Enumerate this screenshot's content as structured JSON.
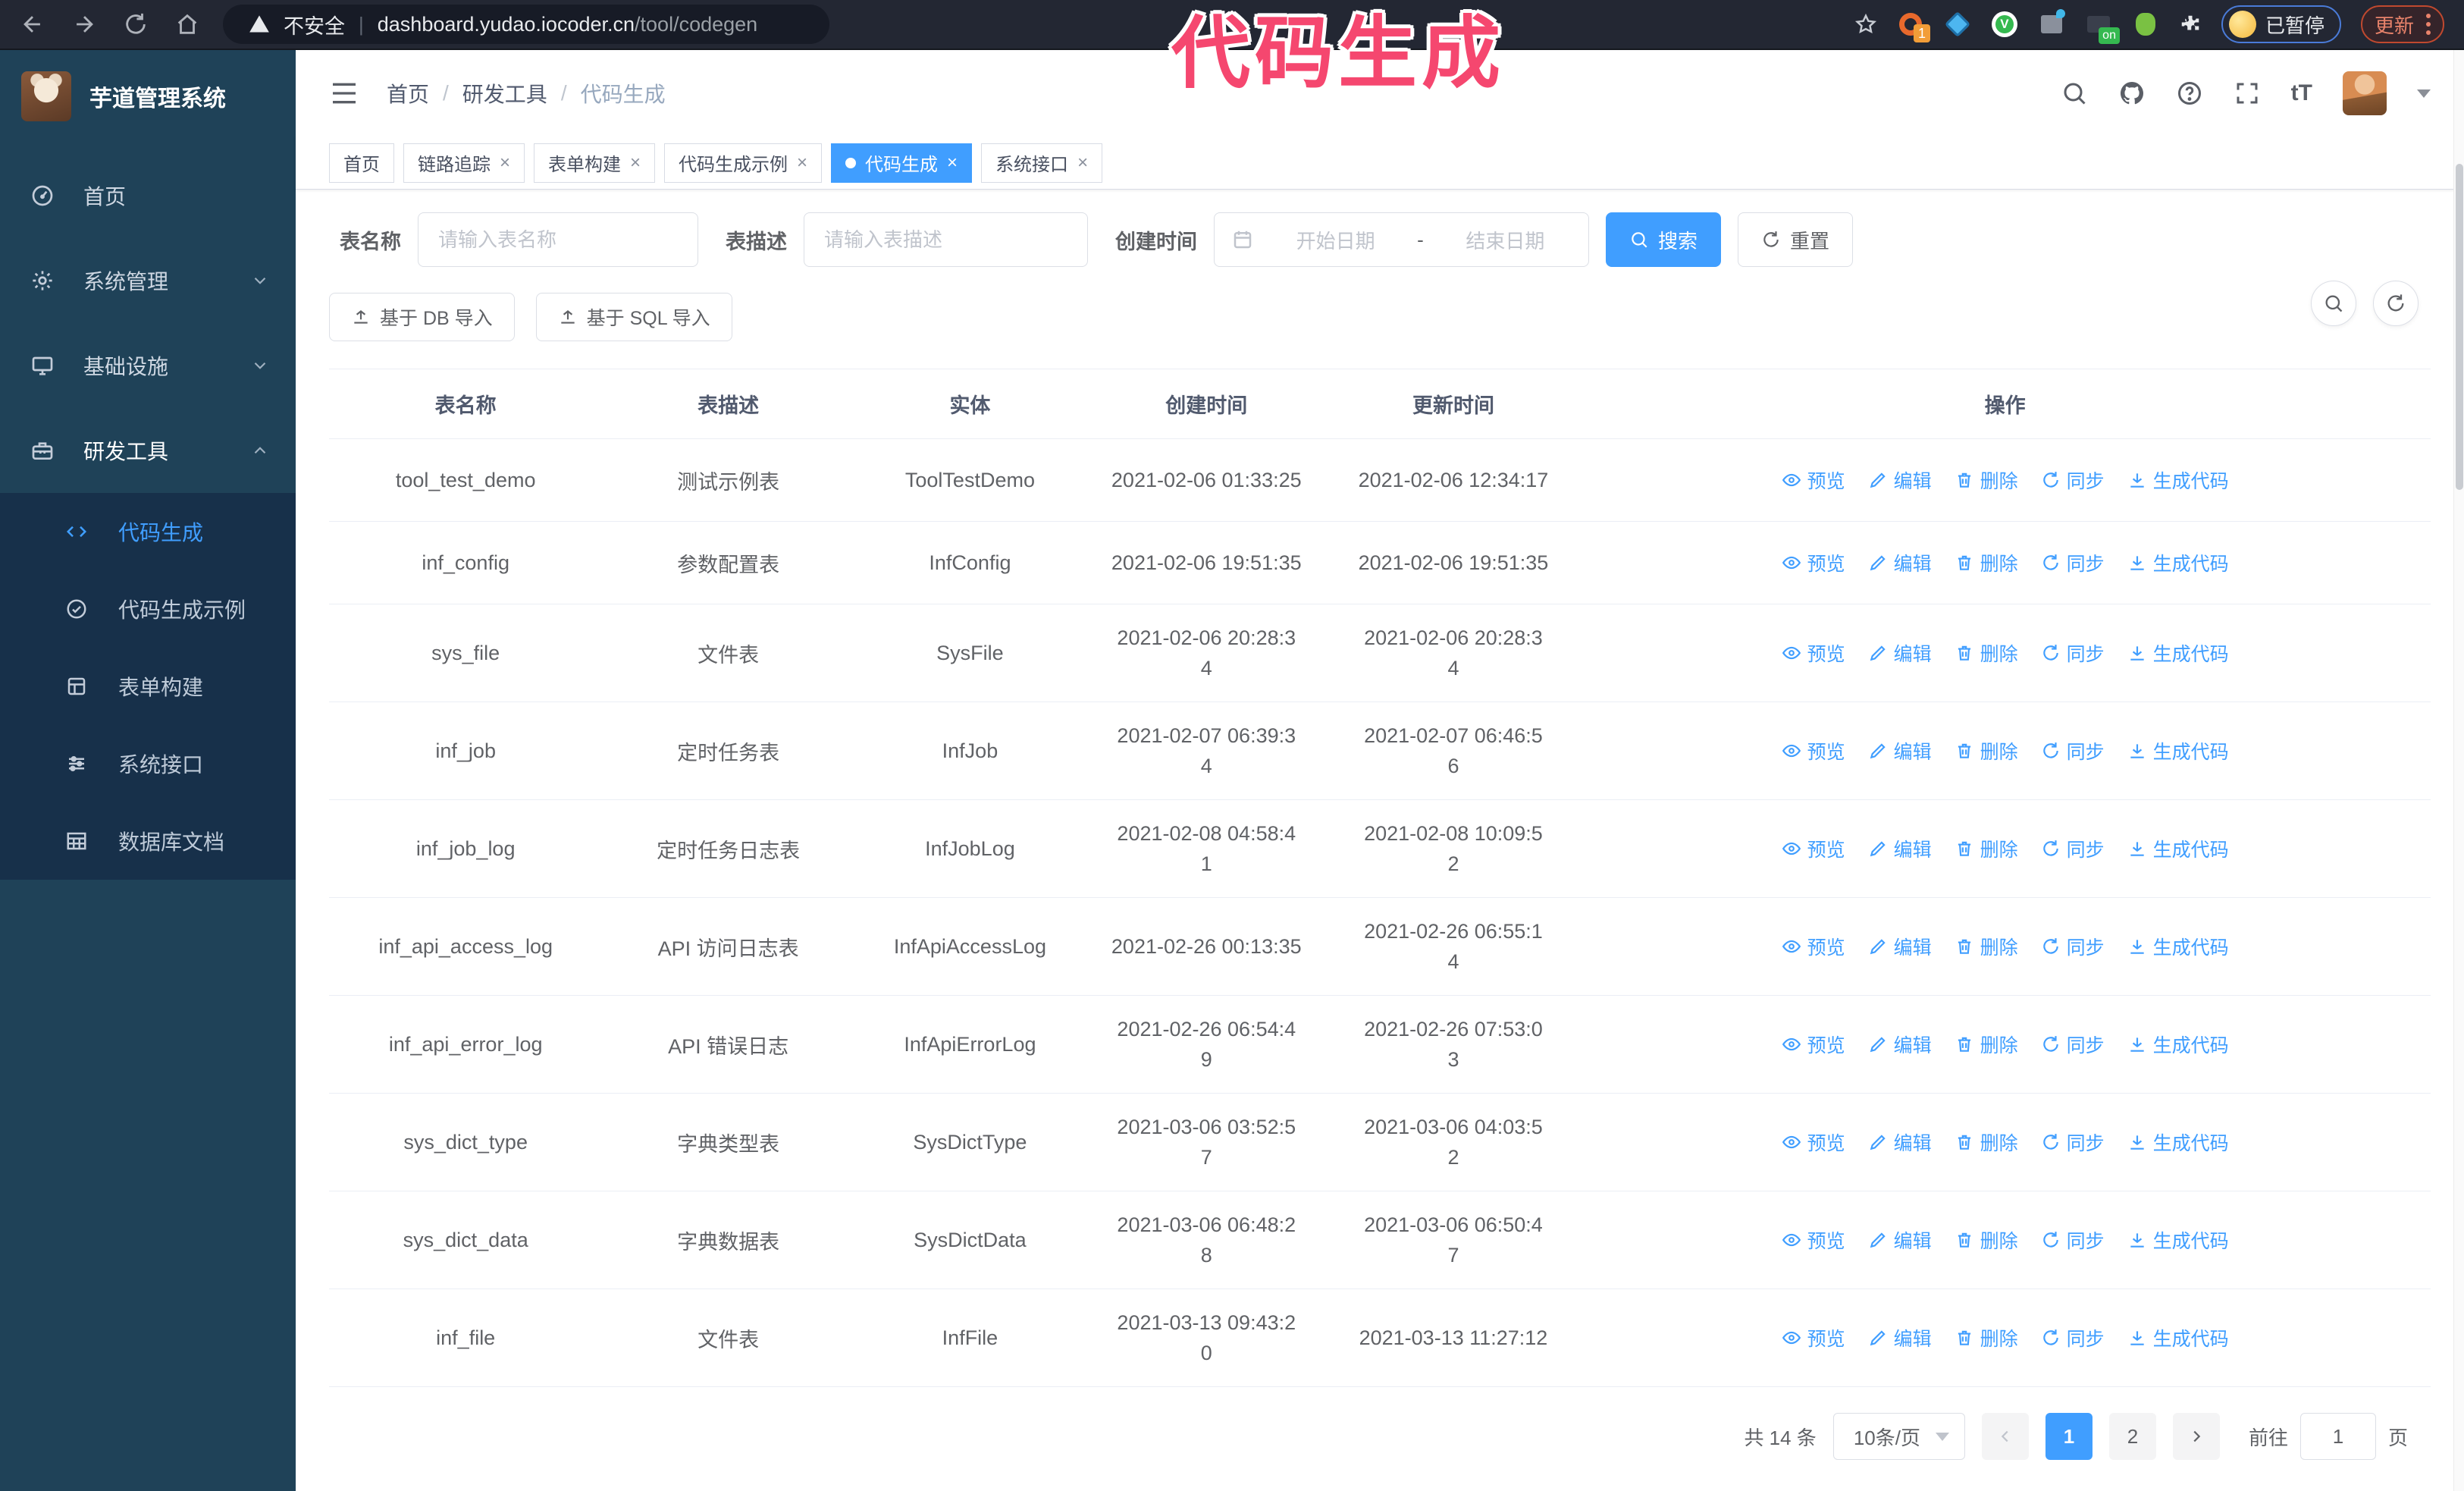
{
  "colors": {
    "accent": "#409eff",
    "sidebar_bg": "#1f4258",
    "submenu_bg": "#17304a",
    "annotation_pink": "#f5476f",
    "browser_bar": "#232733",
    "active_tab": "#409eff"
  },
  "annotation": {
    "text": "代码生成"
  },
  "browser": {
    "security_label": "不安全",
    "url_domain": "dashboard.yudao.iocoder.cn",
    "url_path": "/tool/codegen",
    "extension_badge": "1",
    "extension_on_badge": "on",
    "paused_badge": "已暂停",
    "update_button": "更新"
  },
  "sidebar": {
    "logo_title": "芋道管理系统",
    "items": [
      {
        "icon": "gauge",
        "label": "首页"
      },
      {
        "icon": "gear",
        "label": "系统管理",
        "chevron": "down"
      },
      {
        "icon": "monitor",
        "label": "基础设施",
        "chevron": "down"
      },
      {
        "icon": "toolbox",
        "label": "研发工具",
        "chevron": "up",
        "open": true,
        "children": [
          {
            "icon": "code",
            "label": "代码生成",
            "active": true
          },
          {
            "icon": "example",
            "label": "代码生成示例"
          },
          {
            "icon": "form",
            "label": "表单构建"
          },
          {
            "icon": "sliders",
            "label": "系统接口"
          },
          {
            "icon": "dbtable",
            "label": "数据库文档"
          }
        ]
      }
    ]
  },
  "header": {
    "breadcrumb": [
      "首页",
      "研发工具",
      "代码生成"
    ]
  },
  "tabs": [
    {
      "label": "首页",
      "closable": false,
      "active": false
    },
    {
      "label": "链路追踪",
      "closable": true,
      "active": false
    },
    {
      "label": "表单构建",
      "closable": true,
      "active": false
    },
    {
      "label": "代码生成示例",
      "closable": true,
      "active": false
    },
    {
      "label": "代码生成",
      "closable": true,
      "active": true
    },
    {
      "label": "系统接口",
      "closable": true,
      "active": false
    }
  ],
  "filters": {
    "name_label": "表名称",
    "name_placeholder": "请输入表名称",
    "desc_label": "表描述",
    "desc_placeholder": "请输入表描述",
    "date_label": "创建时间",
    "date_start_placeholder": "开始日期",
    "date_separator": "-",
    "date_end_placeholder": "结束日期",
    "search_label": "搜索",
    "reset_label": "重置"
  },
  "toolbar": {
    "import_db_label": "基于 DB 导入",
    "import_sql_label": "基于 SQL 导入"
  },
  "table": {
    "columns": [
      "表名称",
      "表描述",
      "实体",
      "创建时间",
      "更新时间",
      "操作"
    ],
    "actions": [
      {
        "icon": "eye",
        "label": "预览"
      },
      {
        "icon": "edit",
        "label": "编辑"
      },
      {
        "icon": "trash",
        "label": "删除"
      },
      {
        "icon": "sync",
        "label": "同步"
      },
      {
        "icon": "download",
        "label": "生成代码"
      }
    ],
    "rows": [
      {
        "name": "tool_test_demo",
        "desc": "测试示例表",
        "entity": "ToolTestDemo",
        "created": "2021-02-06 01:33:25",
        "updated": "2021-02-06 12:34:17"
      },
      {
        "name": "inf_config",
        "desc": "参数配置表",
        "entity": "InfConfig",
        "created": "2021-02-06 19:51:35",
        "updated": "2021-02-06 19:51:35"
      },
      {
        "name": "sys_file",
        "desc": "文件表",
        "entity": "SysFile",
        "created": "2021-02-06 20:28:3\n4",
        "updated": "2021-02-06 20:28:3\n4"
      },
      {
        "name": "inf_job",
        "desc": "定时任务表",
        "entity": "InfJob",
        "created": "2021-02-07 06:39:3\n4",
        "updated": "2021-02-07 06:46:5\n6"
      },
      {
        "name": "inf_job_log",
        "desc": "定时任务日志表",
        "entity": "InfJobLog",
        "created": "2021-02-08 04:58:4\n1",
        "updated": "2021-02-08 10:09:5\n2"
      },
      {
        "name": "inf_api_access_log",
        "desc": "API 访问日志表",
        "entity": "InfApiAccessLog",
        "created": "2021-02-26 00:13:35",
        "updated": "2021-02-26 06:55:1\n4"
      },
      {
        "name": "inf_api_error_log",
        "desc": "API 错误日志",
        "entity": "InfApiErrorLog",
        "created": "2021-02-26 06:54:4\n9",
        "updated": "2021-02-26 07:53:0\n3"
      },
      {
        "name": "sys_dict_type",
        "desc": "字典类型表",
        "entity": "SysDictType",
        "created": "2021-03-06 03:52:5\n7",
        "updated": "2021-03-06 04:03:5\n2"
      },
      {
        "name": "sys_dict_data",
        "desc": "字典数据表",
        "entity": "SysDictData",
        "created": "2021-03-06 06:48:2\n8",
        "updated": "2021-03-06 06:50:4\n7"
      },
      {
        "name": "inf_file",
        "desc": "文件表",
        "entity": "InfFile",
        "created": "2021-03-13 09:43:2\n0",
        "updated": "2021-03-13 11:27:12"
      }
    ]
  },
  "pagination": {
    "total_label": "共 14 条",
    "page_size_label": "10条/页",
    "pages": [
      "1",
      "2"
    ],
    "active_page": "1",
    "goto_label": "前往",
    "goto_value": "1",
    "goto_suffix": "页"
  }
}
